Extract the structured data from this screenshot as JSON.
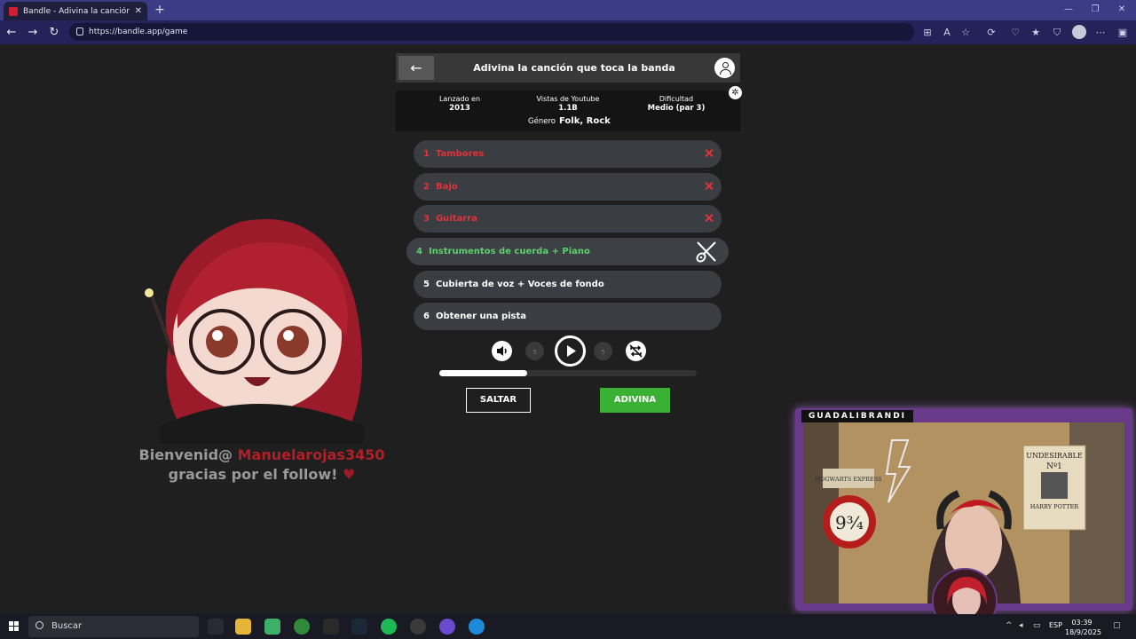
{
  "browser": {
    "tab_title": "Bandle - Adivina la canción, un in",
    "tab_close": "✕",
    "new_tab": "+",
    "url": "https://bandle.app/game"
  },
  "game": {
    "title": "Adivina la canción que toca la banda",
    "info": {
      "released_label": "Lanzado en",
      "released_value": "2013",
      "views_label": "Vistas de Youtube",
      "views_value": "1.1B",
      "difficulty_label": "Dificultad",
      "difficulty_value": "Medio (par 3)",
      "genre_label": "Género",
      "genre_value": "Folk, Rock"
    },
    "tracks": [
      {
        "num": "1",
        "label": "Tambores",
        "state": "wrong"
      },
      {
        "num": "2",
        "label": "Bajo",
        "state": "wrong"
      },
      {
        "num": "3",
        "label": "Guitarra",
        "state": "wrong"
      },
      {
        "num": "4",
        "label": "Instrumentos de cuerda + Piano",
        "state": "current"
      },
      {
        "num": "5",
        "label": "Cubierta de voz + Voces de fondo",
        "state": "locked"
      },
      {
        "num": "6",
        "label": "Obtener una pista",
        "state": "locked"
      }
    ],
    "controls": {
      "rewind_label": "5",
      "forward_label": "5"
    },
    "progress": 0.34,
    "skip_label": "SALTAR",
    "guess_label": "ADIVINA"
  },
  "overlay": {
    "welcome_prefix": "Bienvenid@",
    "welcome_user": "Manuelarojas3450",
    "welcome_line2": "gracias por el follow!",
    "heart": "♥"
  },
  "webcam": {
    "label": "GUADALIBRANDI",
    "poster_top": "UNDESIRABLE",
    "poster_no": "Nº1",
    "poster_name": "HARRY POTTER",
    "sign_platform": "9¾",
    "sign_express": "HOGWARTS EXPRESS"
  },
  "taskbar": {
    "search_placeholder": "Buscar",
    "lang": "ESP",
    "time": "03:39",
    "date": "18/9/2025"
  },
  "colors": {
    "wrong": "#e2323c",
    "current": "#5ed06b",
    "guess_button": "#3ab034",
    "tab_bar": "#3b3b86"
  }
}
